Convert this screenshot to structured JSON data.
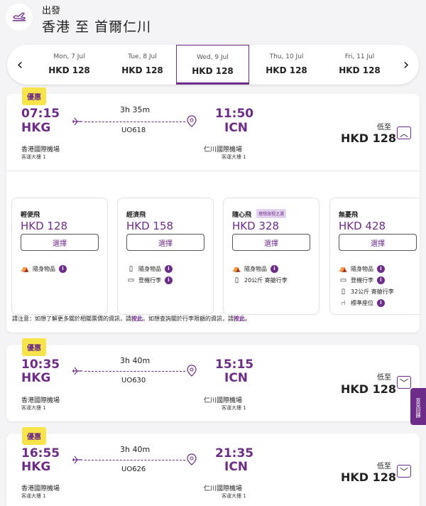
{
  "header": {
    "subtitle": "出發",
    "title": "香港 至 首爾仁川"
  },
  "dates": [
    {
      "day": "Mon, 7 Jul",
      "price": "HKD 128"
    },
    {
      "day": "Tue, 8 Jul",
      "price": "HKD 128"
    },
    {
      "day": "Wed, 9 Jul",
      "price": "HKD 128"
    },
    {
      "day": "Thu, 10 Jul",
      "price": "HKD 128"
    },
    {
      "day": "Fri, 11 Jul",
      "price": "HKD 128"
    }
  ],
  "flights": [
    {
      "badge": "優惠",
      "dep_time": "07:15",
      "dep_code": "HKG",
      "arr_time": "11:50",
      "arr_code": "ICN",
      "duration": "3h 35m",
      "flight_no": "UO618",
      "dep_airport": "香港國際機場",
      "dep_terminal": "客運大樓 1",
      "arr_airport": "仁川國際機場",
      "arr_terminal": "客運大樓 1",
      "from_label": "低至",
      "price": "HKD 128",
      "toggle": "︿"
    },
    {
      "badge": "優惠",
      "dep_time": "10:35",
      "dep_code": "HKG",
      "arr_time": "15:15",
      "arr_code": "ICN",
      "duration": "3h 40m",
      "flight_no": "UO630",
      "dep_airport": "香港國際機場",
      "dep_terminal": "客運大樓 1",
      "arr_airport": "仁川國際機場",
      "arr_terminal": "客運大樓 1",
      "from_label": "低至",
      "price": "HKD 128",
      "toggle": "﹀"
    },
    {
      "badge": "優惠",
      "dep_time": "16:55",
      "dep_code": "HKG",
      "arr_time": "21:35",
      "arr_code": "ICN",
      "duration": "3h 40m",
      "flight_no": "UO626",
      "dep_airport": "香港國際機場",
      "dep_terminal": "客運大樓 1",
      "arr_airport": "仁川國際機場",
      "arr_terminal": "客運大樓 1",
      "from_label": "低至",
      "price": "HKD 128",
      "toggle": "﹀"
    }
  ],
  "fares": [
    {
      "name": "輕便飛",
      "tag": "",
      "price": "HKD 128",
      "button": "選擇",
      "features": [
        {
          "icon": "bag-icon",
          "glyph": "⛺",
          "text": "隨身物品"
        }
      ]
    },
    {
      "name": "經濟飛",
      "tag": "",
      "price": "HKD 158",
      "button": "選擇",
      "features": [
        {
          "icon": "bag-icon",
          "glyph": "▯",
          "text": "隨身物品"
        },
        {
          "icon": "cabin-bag-icon",
          "glyph": "▭",
          "text": "登機行李"
        }
      ]
    },
    {
      "name": "隨心飛",
      "tag": "理想旅程之選",
      "price": "HKD 328",
      "button": "選擇",
      "features": [
        {
          "icon": "bag-icon",
          "glyph": "⛺",
          "text": "隨身物品"
        },
        {
          "icon": "luggage-icon",
          "glyph": "▯",
          "text": "20公斤 寄艙行李"
        }
      ]
    },
    {
      "name": "無憂飛",
      "tag": "",
      "price": "HKD 428",
      "button": "選擇",
      "features": [
        {
          "icon": "bag-icon",
          "glyph": "⛺",
          "text": "隨身物品"
        },
        {
          "icon": "cabin-bag-icon",
          "glyph": "▭",
          "text": "登機行李"
        },
        {
          "icon": "luggage-icon",
          "glyph": "▯",
          "text": "32公斤 寄艙行李"
        },
        {
          "icon": "seat-icon",
          "glyph": "⑁",
          "text": "標準座位"
        }
      ]
    }
  ],
  "note": {
    "part1": "請注意：如想了解更多關於相關票價的資訊，請",
    "link1": "按此",
    "part2": "。如想查詢關於行李限額的資訊，請",
    "link2": "按此",
    "part3": "。"
  },
  "feedback": "意見回饋",
  "colors": {
    "brand": "#6d2c87",
    "badge": "#f7e34a"
  }
}
